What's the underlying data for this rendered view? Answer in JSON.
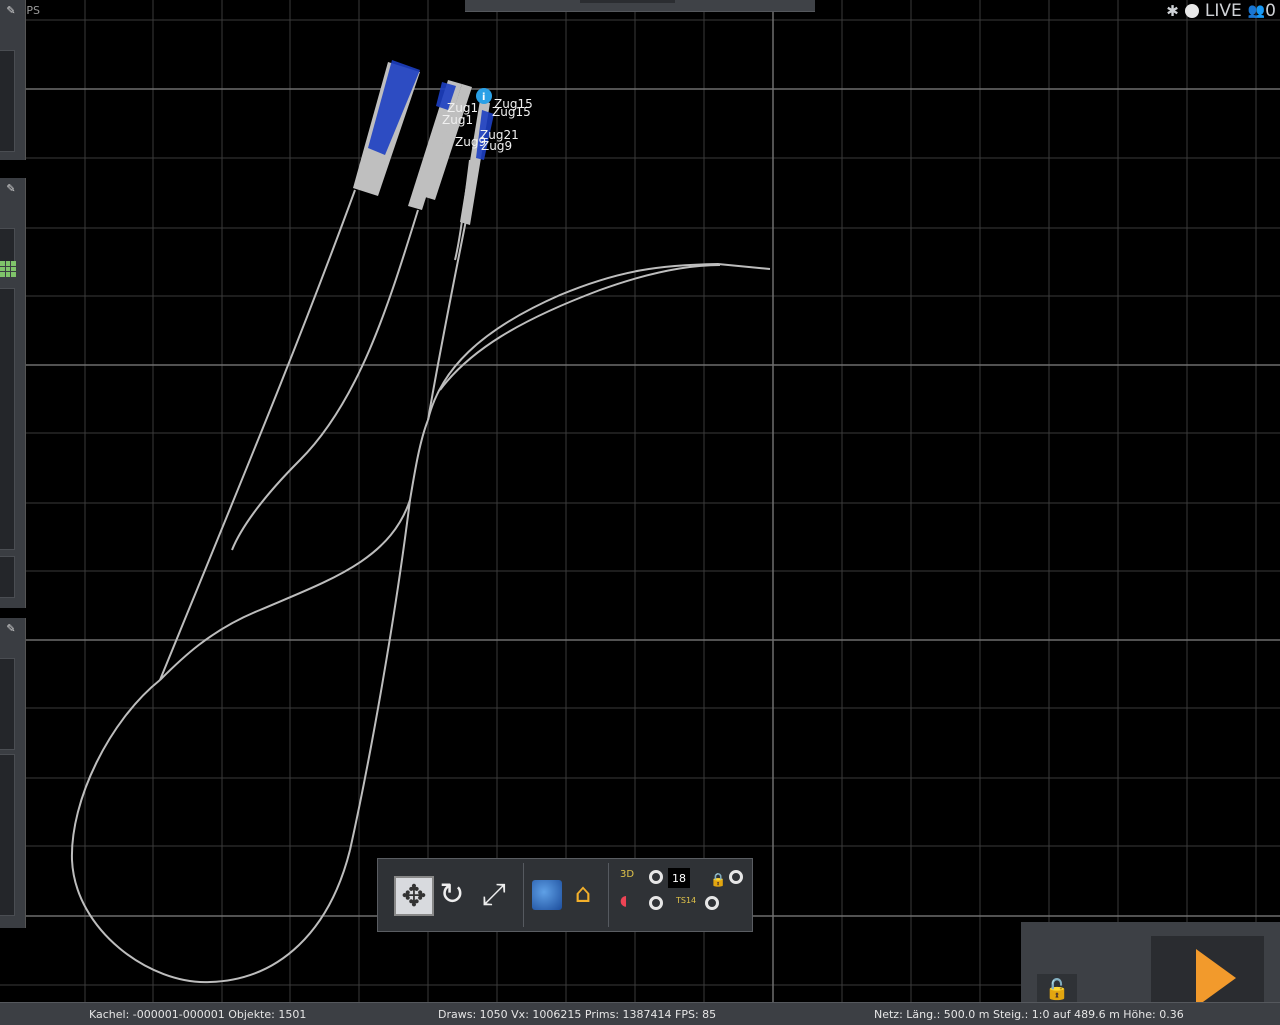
{
  "fps_label": "FPS",
  "status_top": {
    "live_label": "LIVE",
    "user_count": "0"
  },
  "train_labels": [
    "Zug9",
    "Zug1",
    "Zug21",
    "Zug15"
  ],
  "toolbar": {
    "counter": "18",
    "label_3d": "3D",
    "label_ts": "TS14"
  },
  "statusbar": {
    "tile": "Kachel: -000001-000001  Objekte: 1501",
    "stats": "Draws: 1050 Vx: 1006215 Prims: 1387414 FPS: 85",
    "net": "Netz:  Läng.:   500.0 m Steig.: 1:0 auf 489.6 m Höhe:   0.36"
  },
  "icons": [
    "bug-icon",
    "record-dot-icon",
    "users-icon",
    "expand-icon",
    "rotate-icon",
    "resize-icon",
    "earth-icon",
    "home-icon",
    "lock-icon",
    "play-icon",
    "grid-icon"
  ]
}
